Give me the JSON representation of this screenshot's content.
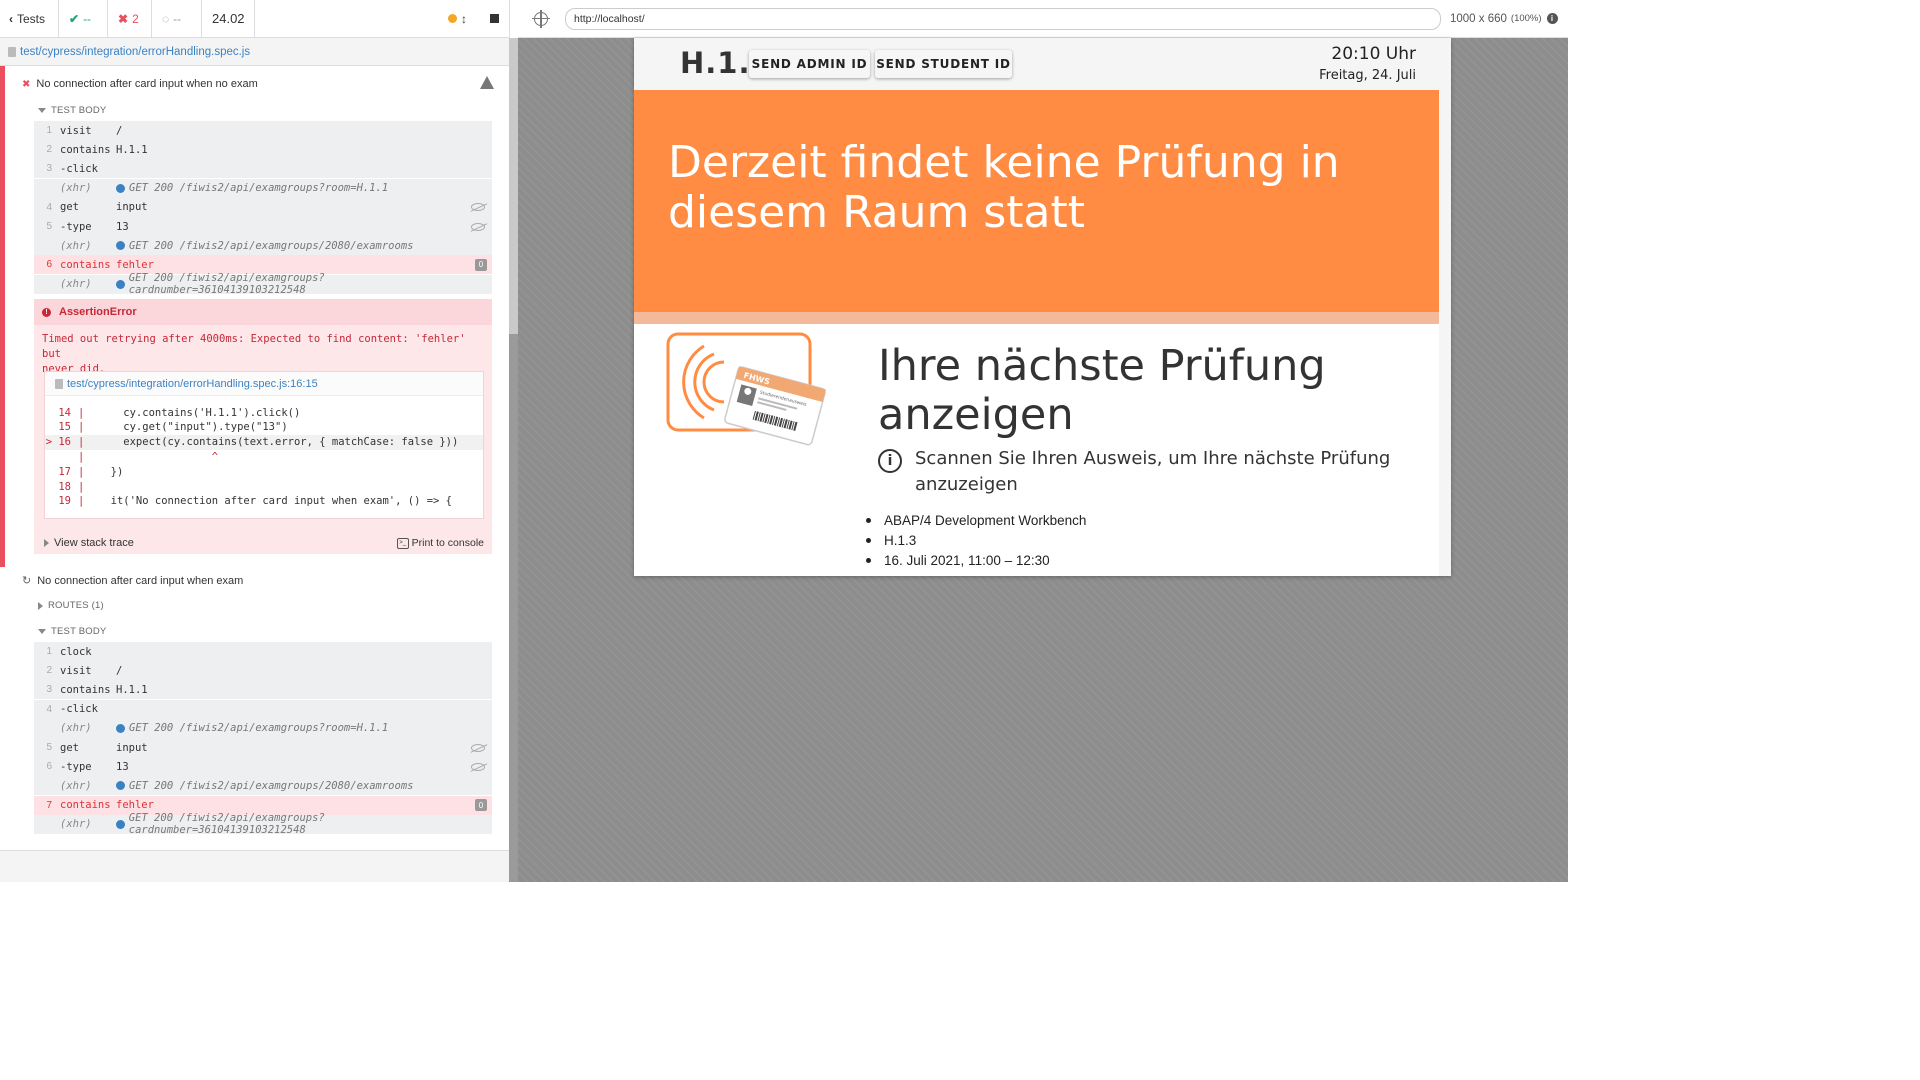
{
  "reporter": {
    "back_label": "Tests",
    "passed": "--",
    "failed": "2",
    "pending": "--",
    "duration": "24.02",
    "spec_path": "test/cypress/integration/errorHandling.spec.js"
  },
  "test1": {
    "title": "No connection after card input when no exam",
    "section": "TEST BODY",
    "commands": [
      {
        "num": "1",
        "name": "visit",
        "msg": "/"
      },
      {
        "num": "2",
        "name": "contains",
        "msg": "H.1.1"
      },
      {
        "num": "3",
        "name": "-click",
        "msg": ""
      },
      {
        "num": "",
        "name": "(xhr)",
        "msg": "GET 200 /fiwis2/api/examgroups?room=H.1.1"
      },
      {
        "num": "4",
        "name": "get",
        "msg": "input"
      },
      {
        "num": "5",
        "name": "-type",
        "msg": "13"
      },
      {
        "num": "",
        "name": "(xhr)",
        "msg": "GET 200 /fiwis2/api/examgroups/2080/examrooms"
      },
      {
        "num": "6",
        "name": "contains",
        "msg": "fehler"
      },
      {
        "num": "",
        "name": "(xhr)",
        "msg": "GET 200 /fiwis2/api/examgroups?cardnumber=36104139103212548"
      }
    ],
    "badge": "0",
    "error": {
      "type": "AssertionError",
      "message_line1": "Timed out retrying after 4000ms: Expected to find content: 'fehler' but",
      "message_line2": "never did.",
      "file": "test/cypress/integration/errorHandling.spec.js:16:15",
      "code": [
        {
          "ln": "14",
          "bar": "|",
          "src": "    cy.contains('H.1.1').click()"
        },
        {
          "ln": "15",
          "bar": "|",
          "src": "    cy.get(\"input\").type(\"13\")"
        },
        {
          "ln": "> 16",
          "bar": "|",
          "src": "    expect(cy.contains(text.error, { matchCase: false }))"
        },
        {
          "ln": "",
          "bar": "|",
          "src": "                  ^"
        },
        {
          "ln": "17",
          "bar": "|",
          "src": "  })"
        },
        {
          "ln": "18",
          "bar": "|",
          "src": ""
        },
        {
          "ln": "19",
          "bar": "|",
          "src": "  it('No connection after card input when exam', () => {"
        }
      ],
      "stack_label": "View stack trace",
      "print_label": "Print to console"
    }
  },
  "test2": {
    "title": "No connection after card input when exam",
    "routes": "ROUTES (1)",
    "section": "TEST BODY",
    "commands": [
      {
        "num": "1",
        "name": "clock",
        "msg": ""
      },
      {
        "num": "2",
        "name": "visit",
        "msg": "/"
      },
      {
        "num": "3",
        "name": "contains",
        "msg": "H.1.1"
      },
      {
        "num": "4",
        "name": "-click",
        "msg": ""
      },
      {
        "num": "",
        "name": "(xhr)",
        "msg": "GET 200 /fiwis2/api/examgroups?room=H.1.1"
      },
      {
        "num": "5",
        "name": "get",
        "msg": "input"
      },
      {
        "num": "6",
        "name": "-type",
        "msg": "13"
      },
      {
        "num": "",
        "name": "(xhr)",
        "msg": "GET 200 /fiwis2/api/examgroups/2080/examrooms"
      },
      {
        "num": "7",
        "name": "contains",
        "msg": "fehler"
      },
      {
        "num": "",
        "name": "(xhr)",
        "msg": "GET 200 /fiwis2/api/examgroups?cardnumber=36104139103212548"
      }
    ],
    "badge": "0"
  },
  "aut": {
    "url": "http://localhost/",
    "viewport": "1000 x 660",
    "scale": "(100%)"
  },
  "app": {
    "room": "H.1.1",
    "btn_admin": "SEND ADMIN ID",
    "btn_student": "SEND STUDENT ID",
    "time": "20:10 Uhr",
    "date": "Freitag, 24. Juli",
    "no_exam": "Derzeit findet keine Prüfung in diesem Raum statt",
    "next_title": "Ihre nächste Prüfung anzeigen",
    "scan_hint": "Scannen Sie Ihren Ausweis, um Ihre nächste Prüfung anzuzeigen",
    "card_label": "FHWS",
    "card_sub": "Studierendenausweis",
    "exam_details": [
      "ABAP/4 Development Workbench",
      "H.1.3",
      "16. Juli 2021, 11:00 – 12:30"
    ]
  },
  "colors": {
    "accent_orange": "#ff8c42",
    "fail_red": "#e94f5f",
    "pass_green": "#1fa971",
    "link_blue": "#3b82c4"
  }
}
